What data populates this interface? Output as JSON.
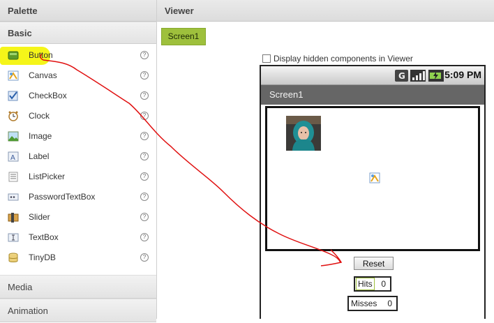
{
  "palette": {
    "title": "Palette",
    "sections": {
      "basic": "Basic",
      "media": "Media",
      "animation": "Animation"
    },
    "components": [
      {
        "label": "Button",
        "icon": "button-icon",
        "help": "?"
      },
      {
        "label": "Canvas",
        "icon": "canvas-icon",
        "help": "?"
      },
      {
        "label": "CheckBox",
        "icon": "checkbox-icon",
        "help": "?"
      },
      {
        "label": "Clock",
        "icon": "clock-icon",
        "help": "?"
      },
      {
        "label": "Image",
        "icon": "image-icon",
        "help": "?"
      },
      {
        "label": "Label",
        "icon": "label-icon",
        "help": "?"
      },
      {
        "label": "ListPicker",
        "icon": "listpicker-icon",
        "help": "?"
      },
      {
        "label": "PasswordTextBox",
        "icon": "password-icon",
        "help": "?"
      },
      {
        "label": "Slider",
        "icon": "slider-icon",
        "help": "?"
      },
      {
        "label": "TextBox",
        "icon": "textbox-icon",
        "help": "?"
      },
      {
        "label": "TinyDB",
        "icon": "database-icon",
        "help": "?"
      }
    ]
  },
  "viewer": {
    "title": "Viewer",
    "screen_tab": "Screen1",
    "hidden_components_label": "Display hidden components in Viewer",
    "phone": {
      "status_time": "5:09 PM",
      "screen_title": "Screen1",
      "reset_label": "Reset",
      "hits_label": "Hits",
      "hits_value": "0",
      "misses_label": "Misses",
      "misses_value": "0"
    }
  },
  "colors": {
    "accent_green": "#9ec03c",
    "highlight_yellow": "#f4f400",
    "annotation_red": "#e01010",
    "title_bar": "#666666"
  }
}
